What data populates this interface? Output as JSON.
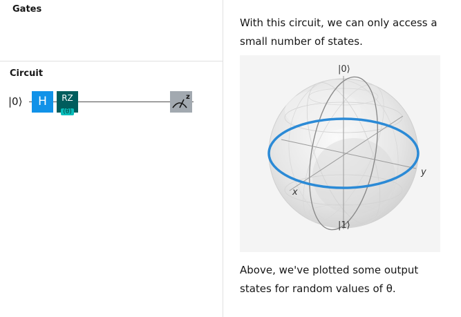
{
  "gates_panel": {
    "title": "Gates"
  },
  "circuit_panel": {
    "title": "Circuit",
    "qubit_label": "|0⟩",
    "gates": [
      {
        "name": "H",
        "color": "#1192e8"
      },
      {
        "name": "RZ",
        "param": "(θ)",
        "color": "#005d5d"
      }
    ],
    "measurement": {
      "icon": "measure-icon",
      "label": "z",
      "color": "#a2a9b0"
    }
  },
  "content": {
    "intro_text": "With this circuit, we can only access a small number of states.",
    "outro_text": "Above, we've plotted some output states for random values of θ."
  },
  "bloch_sphere": {
    "top_label": "|0⟩",
    "bottom_label": "|1⟩",
    "x_label": "x",
    "y_label": "y",
    "highlight_color": "#2b8ad6"
  }
}
